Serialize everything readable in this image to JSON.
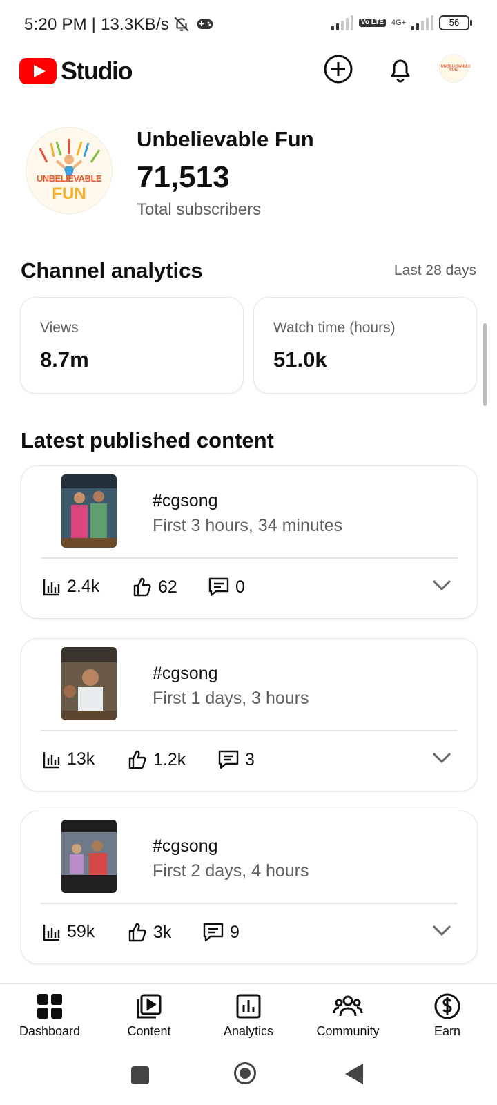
{
  "status_bar": {
    "time": "5:20 PM | 13.3KB/s",
    "volte": "Vo LTE",
    "network": "4G+",
    "battery": "56"
  },
  "app_bar": {
    "logo_text": "Studio",
    "avatar_text": "UNBELIEVABLE FUN"
  },
  "channel": {
    "name": "Unbelievable Fun",
    "subscribers": "71,513",
    "subscribers_label": "Total subscribers",
    "avatar_text_1": "UNBELIEVABLE",
    "avatar_text_2": "FUN"
  },
  "analytics": {
    "title": "Channel analytics",
    "range": "Last 28 days",
    "cards": [
      {
        "label": "Views",
        "value": "8.7m"
      },
      {
        "label": "Watch time (hours)",
        "value": "51.0k"
      }
    ]
  },
  "latest": {
    "title": "Latest published content",
    "items": [
      {
        "title": "#cgsong",
        "subtitle": "First 3 hours, 34 minutes",
        "views": "2.4k",
        "likes": "62",
        "comments": "0"
      },
      {
        "title": "#cgsong",
        "subtitle": "First 1 days, 3 hours",
        "views": "13k",
        "likes": "1.2k",
        "comments": "3"
      },
      {
        "title": "#cgsong",
        "subtitle": "First 2 days, 4 hours",
        "views": "59k",
        "likes": "3k",
        "comments": "9"
      }
    ]
  },
  "bottom_nav": [
    {
      "label": "Dashboard",
      "icon": "dashboard-icon"
    },
    {
      "label": "Content",
      "icon": "content-icon"
    },
    {
      "label": "Analytics",
      "icon": "analytics-icon"
    },
    {
      "label": "Community",
      "icon": "community-icon"
    },
    {
      "label": "Earn",
      "icon": "earn-icon"
    }
  ],
  "colors": {
    "brand_red": "#ff0000",
    "text_primary": "#0f0f0f",
    "text_secondary": "#606060"
  }
}
